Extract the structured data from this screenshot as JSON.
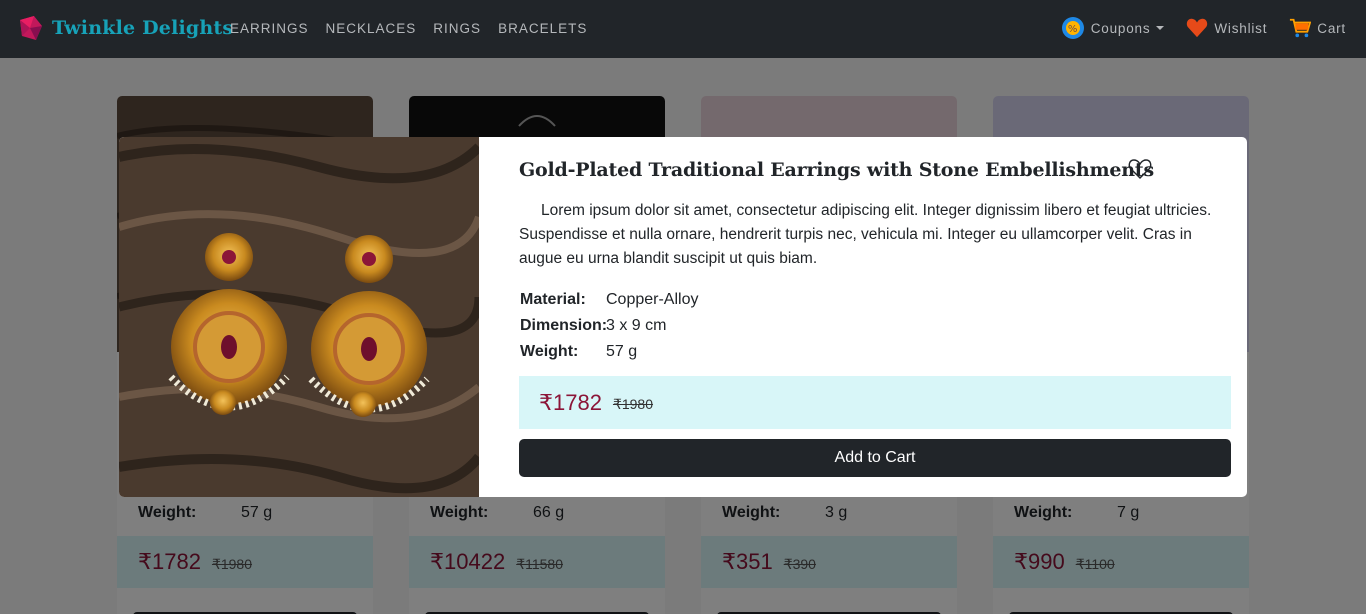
{
  "brand": {
    "name": "Twinkle Delights",
    "icon": "gem-logo-icon"
  },
  "nav": {
    "links": [
      "EARRINGS",
      "NECKLACES",
      "RINGS",
      "BRACELETS"
    ],
    "coupons_label": "Coupons",
    "wishlist_label": "Wishlist",
    "cart_label": "Cart"
  },
  "colors": {
    "accent": "#17a2b8",
    "price": "#8b1538",
    "price_bg": "#d8f6f8",
    "dark": "#212529"
  },
  "cards": [
    {
      "weight_label": "Weight:",
      "weight": "57  g",
      "price": "₹1782",
      "old_price": "₹1980"
    },
    {
      "weight_label": "Weight:",
      "weight": "66  g",
      "price": "₹10422",
      "old_price": "₹11580"
    },
    {
      "weight_label": "Weight:",
      "weight": "3  g",
      "price": "₹351",
      "old_price": "₹390"
    },
    {
      "weight_label": "Weight:",
      "weight": "7  g",
      "price": "₹990",
      "old_price": "₹1100"
    }
  ],
  "modal": {
    "title": "Gold-Plated Traditional Earrings with Stone Embellishments",
    "description": "Lorem ipsum dolor sit amet, consectetur adipiscing elit. Integer dignissim libero et feugiat ultricies. Suspendisse et nulla ornare, hendrerit turpis nec, vehicula mi. Integer eu ullamcorper velit. Cras in augue eu urna blandit suscipit ut quis biam.",
    "specs": [
      {
        "label": "Material:",
        "value": "Copper-Alloy"
      },
      {
        "label": "Dimension:",
        "value": "3 x 9  cm"
      },
      {
        "label": "Weight:",
        "value": "57  g"
      }
    ],
    "price": "₹1782",
    "old_price": "₹1980",
    "add_to_cart": "Add to Cart"
  }
}
